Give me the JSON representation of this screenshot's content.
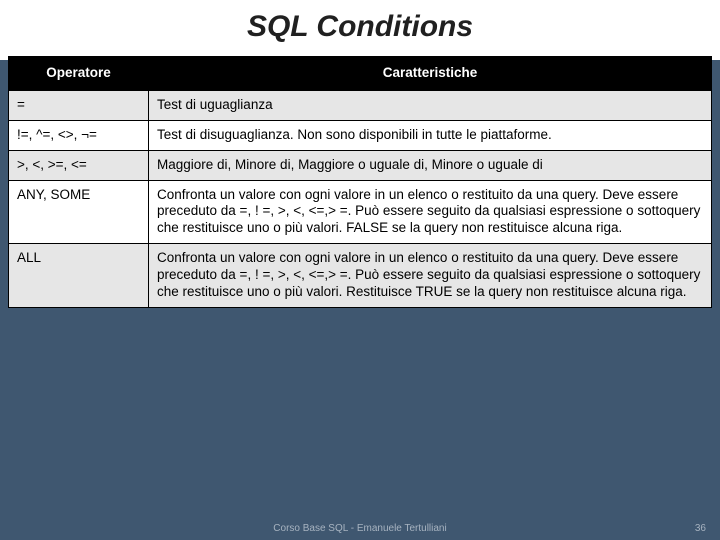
{
  "title": "SQL Conditions",
  "table": {
    "headers": {
      "col1": "Operatore",
      "col2": "Caratteristiche"
    },
    "rows": [
      {
        "op": "=",
        "desc": "Test di uguaglianza"
      },
      {
        "op": "!=, ^=, <>, ¬=",
        "desc": "Test di disuguaglianza. Non sono disponibili in tutte le piattaforme."
      },
      {
        "op": ">, <, >=, <=",
        "desc": "Maggiore di, Minore di, Maggiore o uguale di, Minore o uguale di"
      },
      {
        "op": "ANY, SOME",
        "desc": "Confronta un valore con ogni valore in un elenco o restituito da una query. Deve essere preceduto da =, ! =, >, <, <=,> =. Può essere seguito da qualsiasi espressione o sottoquery che restituisce uno o più valori. FALSE se la query non restituisce alcuna riga."
      },
      {
        "op": "ALL",
        "desc": "Confronta un valore con ogni valore in un elenco o restituito da una query. Deve essere preceduto da =, ! =, >, <, <=,> =. Può essere seguito da qualsiasi espressione o sottoquery che restituisce uno o più valori. Restituisce TRUE se la query non restituisce alcuna riga."
      }
    ]
  },
  "footer": "Corso Base SQL - Emanuele Tertulliani",
  "page": "36"
}
